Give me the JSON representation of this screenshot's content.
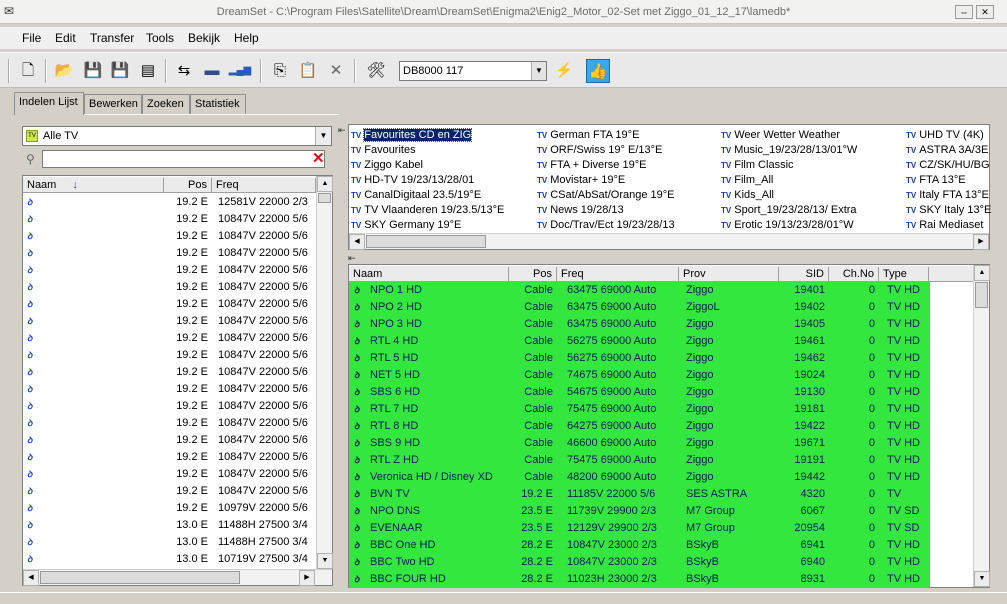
{
  "window": {
    "title": "DreamSet - C:\\Program Files\\Satellite\\Dream\\DreamSet\\Enigma2\\Enig2_Motor_02-Set met Ziggo_01_12_17\\lamedb*",
    "restore_glyph": "⇔",
    "close_glyph": "✕"
  },
  "menu": [
    "File",
    "Edit",
    "Transfer",
    "Tools",
    "Bekijk",
    "Help"
  ],
  "toolbar": {
    "receiver": "DB8000 117",
    "buttons": [
      {
        "name": "new-icon",
        "glyph": "🗋"
      },
      {
        "name": "open-folder-icon",
        "glyph": "📂"
      },
      {
        "name": "save-icon",
        "glyph": "💾"
      },
      {
        "name": "save-as-icon",
        "glyph": "💾"
      },
      {
        "name": "list-icon",
        "glyph": "▤"
      },
      {
        "name": "convert-icon",
        "glyph": "⇆"
      },
      {
        "name": "satellite-dish-icon",
        "glyph": "▬"
      },
      {
        "name": "signal-bars-icon",
        "glyph": "▂▄▆"
      },
      {
        "name": "copy-icon",
        "glyph": "⎘"
      },
      {
        "name": "paste-icon",
        "glyph": "📋"
      },
      {
        "name": "cut-icon",
        "glyph": "✕"
      },
      {
        "name": "tools-icon",
        "glyph": "🛠"
      },
      {
        "name": "connect-icon",
        "glyph": "⚡"
      },
      {
        "name": "thumbs-up-icon",
        "glyph": "👍"
      }
    ]
  },
  "tabs": [
    "Indelen Lijst",
    "Bewerken",
    "Zoeken",
    "Statistiek"
  ],
  "left": {
    "combo": "Alle TV",
    "columns": [
      "Naam",
      "Pos",
      "Freq"
    ],
    "rows": [
      {
        "pos": "19.2 E",
        "freq": "12581V 22000 2/3"
      },
      {
        "pos": "19.2 E",
        "freq": "10847V 22000 5/6"
      },
      {
        "pos": "19.2 E",
        "freq": "10847V 22000 5/6"
      },
      {
        "pos": "19.2 E",
        "freq": "10847V 22000 5/6"
      },
      {
        "pos": "19.2 E",
        "freq": "10847V 22000 5/6"
      },
      {
        "pos": "19.2 E",
        "freq": "10847V 22000 5/6"
      },
      {
        "pos": "19.2 E",
        "freq": "10847V 22000 5/6"
      },
      {
        "pos": "19.2 E",
        "freq": "10847V 22000 5/6"
      },
      {
        "pos": "19.2 E",
        "freq": "10847V 22000 5/6"
      },
      {
        "pos": "19.2 E",
        "freq": "10847V 22000 5/6"
      },
      {
        "pos": "19.2 E",
        "freq": "10847V 22000 5/6"
      },
      {
        "pos": "19.2 E",
        "freq": "10847V 22000 5/6"
      },
      {
        "pos": "19.2 E",
        "freq": "10847V 22000 5/6"
      },
      {
        "pos": "19.2 E",
        "freq": "10847V 22000 5/6"
      },
      {
        "pos": "19.2 E",
        "freq": "10847V 22000 5/6"
      },
      {
        "pos": "19.2 E",
        "freq": "10847V 22000 5/6"
      },
      {
        "pos": "19.2 E",
        "freq": "10847V 22000 5/6"
      },
      {
        "pos": "19.2 E",
        "freq": "10847V 22000 5/6"
      },
      {
        "pos": "19.2 E",
        "freq": "10979V 22000 5/6"
      },
      {
        "pos": "13.0 E",
        "freq": "11488H 27500 3/4"
      },
      {
        "pos": "13.0 E",
        "freq": "11488H 27500 3/4"
      },
      {
        "pos": "13.0 E",
        "freq": "10719V 27500 3/4"
      }
    ]
  },
  "favourites": [
    [
      "Favourites CD en ZIG",
      "Favourites",
      "Ziggo Kabel",
      "HD-TV 19/23/13/28/01",
      "CanalDigitaal  23.5/19°E",
      "TV Vlaanderen 19/23.5/13°E",
      "SKY Germany 19°E"
    ],
    [
      "German FTA  19°E",
      "ORF/Swiss 19° E/13°E",
      "FTA + Diverse 19°E",
      "Movistar+ 19°E",
      "CSat/AbSat/Orange 19°E",
      "News 19/28/13",
      "Doc/Trav/Ect 19/23/28/13"
    ],
    [
      "Weer Wetter Weather",
      "Music_19/23/28/13/01°W",
      "Film Classic",
      "Film_All",
      "Kids_All",
      "Sport_19/23/28/13/ Extra",
      "Erotic 19/13/23/28/01°W"
    ],
    [
      "UHD TV (4K)",
      "ASTRA 3A/3E",
      "CZ/SK/HU/BG",
      "FTA 13°E",
      "Italy FTA 13°E",
      "SKY Italy 13°E",
      "Rai Mediaset"
    ]
  ],
  "fav_tag": "TV",
  "channels": {
    "columns": [
      "Naam",
      "Pos",
      "Freq",
      "Prov",
      "SID",
      "Ch.No",
      "Type"
    ],
    "rows": [
      {
        "naam": "NPO 1 HD",
        "pos": "Cable",
        "freq": "63475 69000 Auto",
        "prov": "Ziggo",
        "sid": "19401",
        "chno": "0",
        "type": "TV HD"
      },
      {
        "naam": "NPO 2 HD",
        "pos": "Cable",
        "freq": "63475 69000 Auto",
        "prov": "ZiggoL",
        "sid": "19402",
        "chno": "0",
        "type": "TV HD"
      },
      {
        "naam": "NPO 3 HD",
        "pos": "Cable",
        "freq": "63475 69000 Auto",
        "prov": "Ziggo",
        "sid": "19405",
        "chno": "0",
        "type": "TV HD"
      },
      {
        "naam": "RTL 4 HD",
        "pos": "Cable",
        "freq": "56275 69000 Auto",
        "prov": "Ziggo",
        "sid": "19461",
        "chno": "0",
        "type": "TV HD"
      },
      {
        "naam": "RTL 5 HD",
        "pos": "Cable",
        "freq": "56275 69000 Auto",
        "prov": "Ziggo",
        "sid": "19462",
        "chno": "0",
        "type": "TV HD"
      },
      {
        "naam": "NET 5 HD",
        "pos": "Cable",
        "freq": "74675 69000 Auto",
        "prov": "Ziggo",
        "sid": "19024",
        "chno": "0",
        "type": "TV HD"
      },
      {
        "naam": "SBS 6 HD",
        "pos": "Cable",
        "freq": "54675 69000 Auto",
        "prov": "Ziggo",
        "sid": "19130",
        "chno": "0",
        "type": "TV HD"
      },
      {
        "naam": "RTL 7 HD",
        "pos": "Cable",
        "freq": "75475 69000 Auto",
        "prov": "Ziggo",
        "sid": "19181",
        "chno": "0",
        "type": "TV HD"
      },
      {
        "naam": "RTL 8 HD",
        "pos": "Cable",
        "freq": "64275 69000 Auto",
        "prov": "Ziggo",
        "sid": "19422",
        "chno": "0",
        "type": "TV HD"
      },
      {
        "naam": "SBS 9 HD",
        "pos": "Cable",
        "freq": "46600 69000 Auto",
        "prov": "Ziggo",
        "sid": "19671",
        "chno": "0",
        "type": "TV HD"
      },
      {
        "naam": "RTL Z HD",
        "pos": "Cable",
        "freq": "75475 69000 Auto",
        "prov": "Ziggo",
        "sid": "19191",
        "chno": "0",
        "type": "TV HD"
      },
      {
        "naam": "Veronica HD / Disney XD",
        "pos": "Cable",
        "freq": "48200 69000 Auto",
        "prov": "Ziggo",
        "sid": "19442",
        "chno": "0",
        "type": "TV HD"
      },
      {
        "naam": "BVN TV",
        "pos": "19.2 E",
        "freq": "11185V 22000 5/6",
        "prov": "SES ASTRA",
        "sid": "4320",
        "chno": "0",
        "type": "TV"
      },
      {
        "naam": "NPO DNS",
        "pos": "23.5 E",
        "freq": "11739V 29900 2/3",
        "prov": "M7 Group",
        "sid": "6067",
        "chno": "0",
        "type": "TV SD"
      },
      {
        "naam": "EVENAAR",
        "pos": "23.5 E",
        "freq": "12129V 29900 2/3",
        "prov": "M7 Group",
        "sid": "20954",
        "chno": "0",
        "type": "TV SD"
      },
      {
        "naam": "BBC One HD",
        "pos": "28.2 E",
        "freq": "10847V 23000 2/3",
        "prov": "BSkyB",
        "sid": "6941",
        "chno": "0",
        "type": "TV HD"
      },
      {
        "naam": "BBC Two HD",
        "pos": "28.2 E",
        "freq": "10847V 23000 2/3",
        "prov": "BSkyB",
        "sid": "6940",
        "chno": "0",
        "type": "TV HD"
      },
      {
        "naam": "BBC FOUR HD",
        "pos": "28.2 E",
        "freq": "11023H 23000 2/3",
        "prov": "BSkyB",
        "sid": "8931",
        "chno": "0",
        "type": "TV HD"
      }
    ]
  },
  "colors": {
    "row_highlight": "#33e73e",
    "selection": "#0a246a",
    "clear_icon": "#d21414"
  }
}
